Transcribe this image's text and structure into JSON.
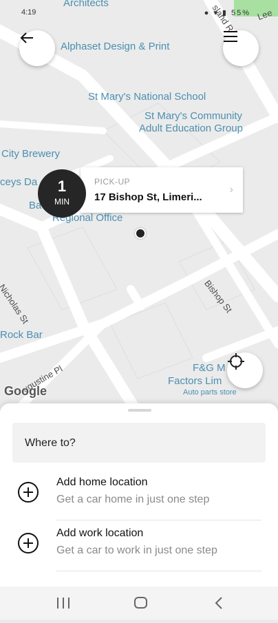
{
  "status_bar": {
    "time": "4:19",
    "battery": "55%"
  },
  "map": {
    "pois": [
      {
        "id": "architects",
        "text": "Architects"
      },
      {
        "id": "alphaset",
        "text": "Alphaset Design & Print"
      },
      {
        "id": "stmarys",
        "text": "St Mary's National School"
      },
      {
        "id": "community1",
        "text": "St Mary's Community"
      },
      {
        "id": "community2",
        "text": "Adult Education Group"
      },
      {
        "id": "brewery",
        "text": "City Brewery"
      },
      {
        "id": "daceys",
        "text": "ceys Da"
      },
      {
        "id": "bank",
        "text": "Ba"
      },
      {
        "id": "regional",
        "text": "Regional Office"
      },
      {
        "id": "rockbar",
        "text": "Rock Bar"
      },
      {
        "id": "fg1",
        "text": "F&G M"
      },
      {
        "id": "fg2",
        "text": "Factors Lim"
      },
      {
        "id": "autoparts",
        "text": "Auto parts store"
      }
    ],
    "streets": {
      "nicholas": "Nicholas St",
      "bishop": "Bishop St",
      "augustine": "ugustine Pl",
      "island": "sland R",
      "lee": "Lee"
    },
    "attribution": "Google"
  },
  "pickup": {
    "eta_value": "1",
    "eta_unit": "MIN",
    "label": "PICK-UP",
    "address": "17 Bishop St, Limeri..."
  },
  "sheet": {
    "search_placeholder": "Where to?",
    "rows": [
      {
        "title": "Add home location",
        "subtitle": "Get a car home in just one step"
      },
      {
        "title": "Add work location",
        "subtitle": "Get a car to work in just one step"
      }
    ]
  },
  "colors": {
    "poi": "#4b8fb0",
    "map_bg": "#ebebeb",
    "road": "#ffffff",
    "eta_bg": "#262626"
  },
  "icons": [
    "back-arrow-icon",
    "menu-icon",
    "locate-icon",
    "plus-circle-icon",
    "recent-apps-icon",
    "home-icon",
    "back-icon"
  ]
}
